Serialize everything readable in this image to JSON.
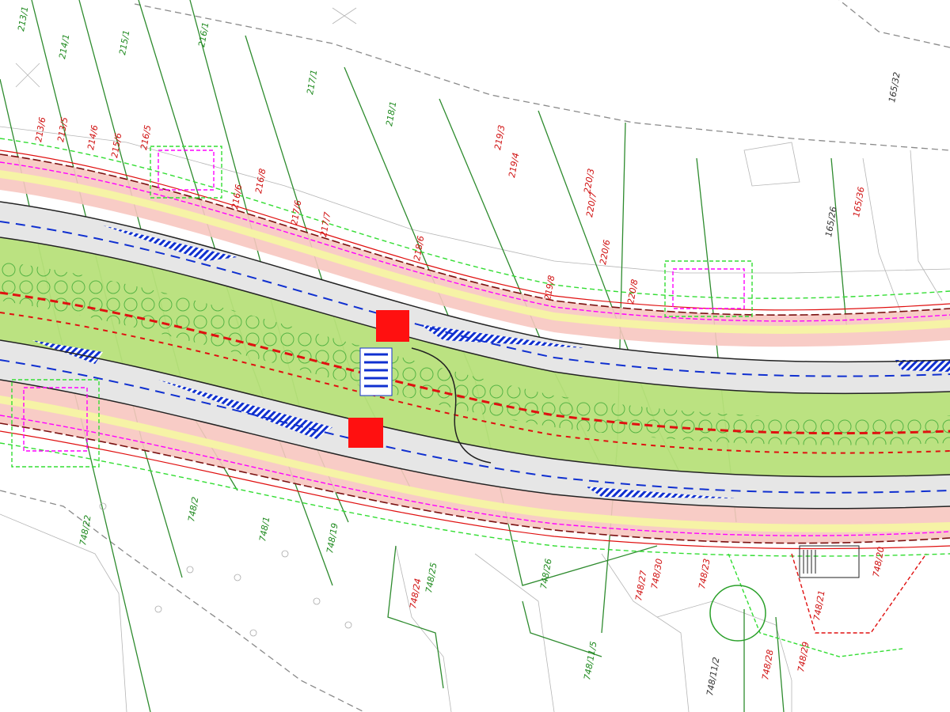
{
  "colors": {
    "background": "#ffffff",
    "parcel_line": "#2e8b2e",
    "boundary_dashed": "#888888",
    "road_asphalt": "#e6e6e6",
    "green_strip": "#b7e07a",
    "pink_strip": "#f7c7c0",
    "yellow_strip": "#f6f3a6",
    "hatch_blue": "#1030d0",
    "red_line": "#e01010",
    "magenta_line": "#ff00ff",
    "green_dashed": "#33dd33",
    "crossing_red": "#ff1010"
  },
  "icons": [
    "tree-symbol-icon",
    "crosswalk-icon",
    "roundabout-icon"
  ],
  "parcels_green": [
    {
      "id": "p1",
      "label": "213/1"
    },
    {
      "id": "p2",
      "label": "214/1"
    },
    {
      "id": "p3",
      "label": "215/1"
    },
    {
      "id": "p4",
      "label": "216/1"
    },
    {
      "id": "p5",
      "label": "217/1"
    },
    {
      "id": "p6",
      "label": "218/1"
    },
    {
      "id": "p7",
      "label": "219/4"
    },
    {
      "id": "p8",
      "label": "219/3"
    },
    {
      "id": "p9",
      "label": "220/7"
    },
    {
      "id": "p10",
      "label": "220/3"
    },
    {
      "id": "p11",
      "label": "165/26"
    },
    {
      "id": "p12",
      "label": "165/32"
    },
    {
      "id": "p13",
      "label": "748/22"
    },
    {
      "id": "p14",
      "label": "748/2"
    },
    {
      "id": "p15",
      "label": "748/1"
    },
    {
      "id": "p16",
      "label": "748/19"
    },
    {
      "id": "p17",
      "label": "748/24"
    },
    {
      "id": "p18",
      "label": "748/25"
    },
    {
      "id": "p19",
      "label": "748/26"
    },
    {
      "id": "p20",
      "label": "748/27"
    },
    {
      "id": "p21",
      "label": "748/11/5"
    },
    {
      "id": "p22",
      "label": "748/11/2"
    }
  ],
  "parcels_red": [
    {
      "id": "r1",
      "label": "213/6"
    },
    {
      "id": "r2",
      "label": "213/5"
    },
    {
      "id": "r3",
      "label": "214/6"
    },
    {
      "id": "r4",
      "label": "215/6"
    },
    {
      "id": "r5",
      "label": "216/5"
    },
    {
      "id": "r6",
      "label": "216/6"
    },
    {
      "id": "r7",
      "label": "216/8"
    },
    {
      "id": "r8",
      "label": "217/6"
    },
    {
      "id": "r9",
      "label": "217/7"
    },
    {
      "id": "r10",
      "label": "218/6"
    },
    {
      "id": "r11",
      "label": "219/8"
    },
    {
      "id": "r12",
      "label": "220/8"
    },
    {
      "id": "r13",
      "label": "220/6"
    },
    {
      "id": "r14",
      "label": "165/36"
    },
    {
      "id": "r15",
      "label": "748/20"
    },
    {
      "id": "r16",
      "label": "748/23"
    },
    {
      "id": "r17",
      "label": "748/21"
    },
    {
      "id": "r18",
      "label": "748/28"
    },
    {
      "id": "r19",
      "label": "748/29"
    },
    {
      "id": "r20",
      "label": "748/30"
    }
  ]
}
